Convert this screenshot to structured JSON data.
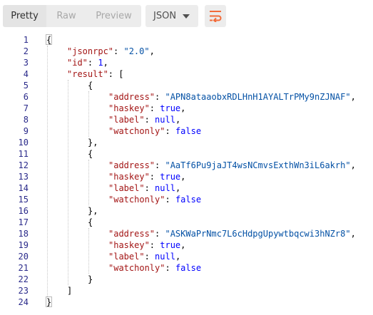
{
  "toolbar": {
    "tabs": [
      {
        "label": "Pretty",
        "active": true
      },
      {
        "label": "Raw",
        "active": false
      },
      {
        "label": "Preview",
        "active": false
      }
    ],
    "format": {
      "selected": "JSON",
      "icon": "chevron-down-icon"
    },
    "wrap": {
      "icon": "wrap-lines-icon",
      "color": "#f26b3a"
    }
  },
  "editor": {
    "lines": [
      {
        "n": "1",
        "indent": 0,
        "tokens": [
          {
            "t": "p",
            "v": "{"
          }
        ]
      },
      {
        "n": "2",
        "indent": 1,
        "tokens": [
          {
            "t": "k",
            "v": "\"jsonrpc\""
          },
          {
            "t": "p",
            "v": ": "
          },
          {
            "t": "s",
            "v": "\"2.0\""
          },
          {
            "t": "p",
            "v": ","
          }
        ]
      },
      {
        "n": "3",
        "indent": 1,
        "tokens": [
          {
            "t": "k",
            "v": "\"id\""
          },
          {
            "t": "p",
            "v": ": "
          },
          {
            "t": "v",
            "v": "1"
          },
          {
            "t": "p",
            "v": ","
          }
        ]
      },
      {
        "n": "4",
        "indent": 1,
        "tokens": [
          {
            "t": "k",
            "v": "\"result\""
          },
          {
            "t": "p",
            "v": ": ["
          }
        ]
      },
      {
        "n": "5",
        "indent": 2,
        "tokens": [
          {
            "t": "p",
            "v": "{"
          }
        ]
      },
      {
        "n": "6",
        "indent": 3,
        "tokens": [
          {
            "t": "k",
            "v": "\"address\""
          },
          {
            "t": "p",
            "v": ": "
          },
          {
            "t": "s",
            "v": "\"APN8ataaobxRDLHnH1AYALTrPMy9nZJNAF\""
          },
          {
            "t": "p",
            "v": ","
          }
        ]
      },
      {
        "n": "7",
        "indent": 3,
        "tokens": [
          {
            "t": "k",
            "v": "\"haskey\""
          },
          {
            "t": "p",
            "v": ": "
          },
          {
            "t": "v",
            "v": "true"
          },
          {
            "t": "p",
            "v": ","
          }
        ]
      },
      {
        "n": "8",
        "indent": 3,
        "tokens": [
          {
            "t": "k",
            "v": "\"label\""
          },
          {
            "t": "p",
            "v": ": "
          },
          {
            "t": "v",
            "v": "null"
          },
          {
            "t": "p",
            "v": ","
          }
        ]
      },
      {
        "n": "9",
        "indent": 3,
        "tokens": [
          {
            "t": "k",
            "v": "\"watchonly\""
          },
          {
            "t": "p",
            "v": ": "
          },
          {
            "t": "v",
            "v": "false"
          }
        ]
      },
      {
        "n": "10",
        "indent": 2,
        "tokens": [
          {
            "t": "p",
            "v": "},"
          }
        ]
      },
      {
        "n": "11",
        "indent": 2,
        "tokens": [
          {
            "t": "p",
            "v": "{"
          }
        ]
      },
      {
        "n": "12",
        "indent": 3,
        "tokens": [
          {
            "t": "k",
            "v": "\"address\""
          },
          {
            "t": "p",
            "v": ": "
          },
          {
            "t": "s",
            "v": "\"AaTf6Pu9jaJT4wsNCmvsExthWn3iL6akrh\""
          },
          {
            "t": "p",
            "v": ","
          }
        ]
      },
      {
        "n": "13",
        "indent": 3,
        "tokens": [
          {
            "t": "k",
            "v": "\"haskey\""
          },
          {
            "t": "p",
            "v": ": "
          },
          {
            "t": "v",
            "v": "true"
          },
          {
            "t": "p",
            "v": ","
          }
        ]
      },
      {
        "n": "14",
        "indent": 3,
        "tokens": [
          {
            "t": "k",
            "v": "\"label\""
          },
          {
            "t": "p",
            "v": ": "
          },
          {
            "t": "v",
            "v": "null"
          },
          {
            "t": "p",
            "v": ","
          }
        ]
      },
      {
        "n": "15",
        "indent": 3,
        "tokens": [
          {
            "t": "k",
            "v": "\"watchonly\""
          },
          {
            "t": "p",
            "v": ": "
          },
          {
            "t": "v",
            "v": "false"
          }
        ]
      },
      {
        "n": "16",
        "indent": 2,
        "tokens": [
          {
            "t": "p",
            "v": "},"
          }
        ]
      },
      {
        "n": "17",
        "indent": 2,
        "tokens": [
          {
            "t": "p",
            "v": "{"
          }
        ]
      },
      {
        "n": "18",
        "indent": 3,
        "tokens": [
          {
            "t": "k",
            "v": "\"address\""
          },
          {
            "t": "p",
            "v": ": "
          },
          {
            "t": "s",
            "v": "\"ASKWaPrNmc7L6cHdpgUpywtbqcwi3hNZr8\""
          },
          {
            "t": "p",
            "v": ","
          }
        ]
      },
      {
        "n": "19",
        "indent": 3,
        "tokens": [
          {
            "t": "k",
            "v": "\"haskey\""
          },
          {
            "t": "p",
            "v": ": "
          },
          {
            "t": "v",
            "v": "true"
          },
          {
            "t": "p",
            "v": ","
          }
        ]
      },
      {
        "n": "20",
        "indent": 3,
        "tokens": [
          {
            "t": "k",
            "v": "\"label\""
          },
          {
            "t": "p",
            "v": ": "
          },
          {
            "t": "v",
            "v": "null"
          },
          {
            "t": "p",
            "v": ","
          }
        ]
      },
      {
        "n": "21",
        "indent": 3,
        "tokens": [
          {
            "t": "k",
            "v": "\"watchonly\""
          },
          {
            "t": "p",
            "v": ": "
          },
          {
            "t": "v",
            "v": "false"
          }
        ]
      },
      {
        "n": "22",
        "indent": 2,
        "tokens": [
          {
            "t": "p",
            "v": "}"
          }
        ]
      },
      {
        "n": "23",
        "indent": 1,
        "tokens": [
          {
            "t": "p",
            "v": "]"
          }
        ]
      },
      {
        "n": "24",
        "indent": 0,
        "tokens": [
          {
            "t": "p",
            "v": "}"
          }
        ]
      }
    ]
  }
}
